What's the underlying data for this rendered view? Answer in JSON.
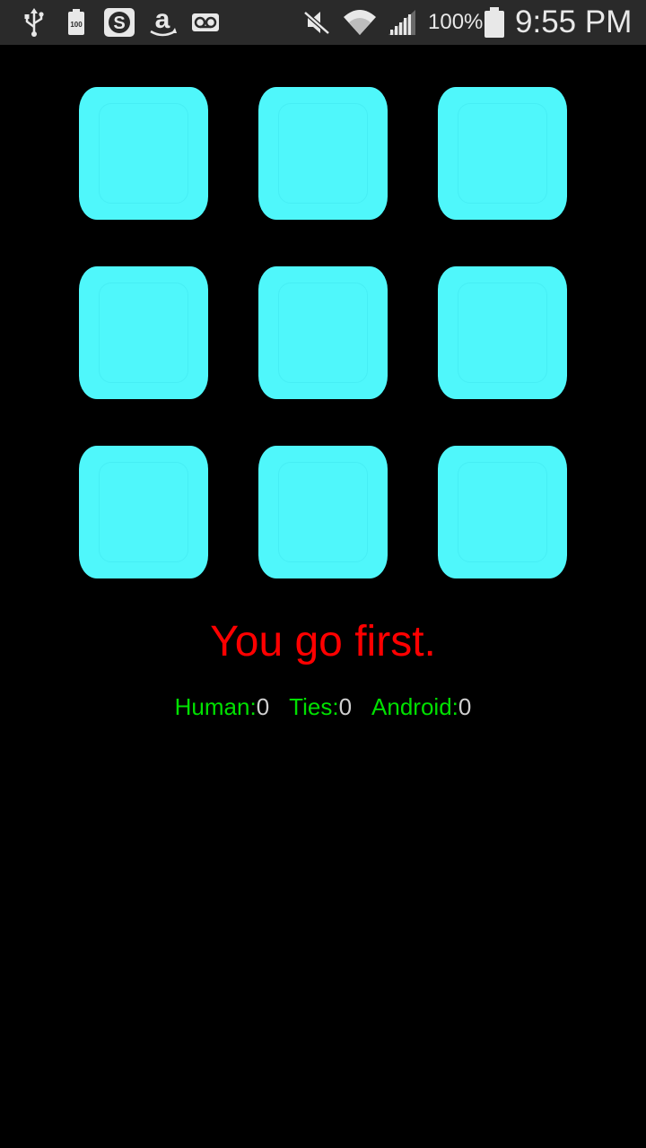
{
  "status_bar": {
    "battery_percent": "100%",
    "time": "9:55 PM",
    "left_icons": [
      "usb-icon",
      "battery-100-icon",
      "skype-icon",
      "amazon-icon",
      "voicemail-icon"
    ],
    "right_icons": [
      "mute-icon",
      "wifi-icon",
      "signal-icon",
      "battery-icon"
    ],
    "background_color": "#2a2a2a"
  },
  "board": {
    "cells": [
      "",
      "",
      "",
      "",
      "",
      "",
      "",
      "",
      ""
    ],
    "cell_color": "#4ff7fb"
  },
  "message": {
    "text": "You go first.",
    "color": "#ff0000"
  },
  "scores": {
    "human_label": "Human:",
    "human_value": "0",
    "ties_label": "Ties:",
    "ties_value": "0",
    "android_label": "Android:",
    "android_value": "0",
    "label_color": "#00e000"
  }
}
